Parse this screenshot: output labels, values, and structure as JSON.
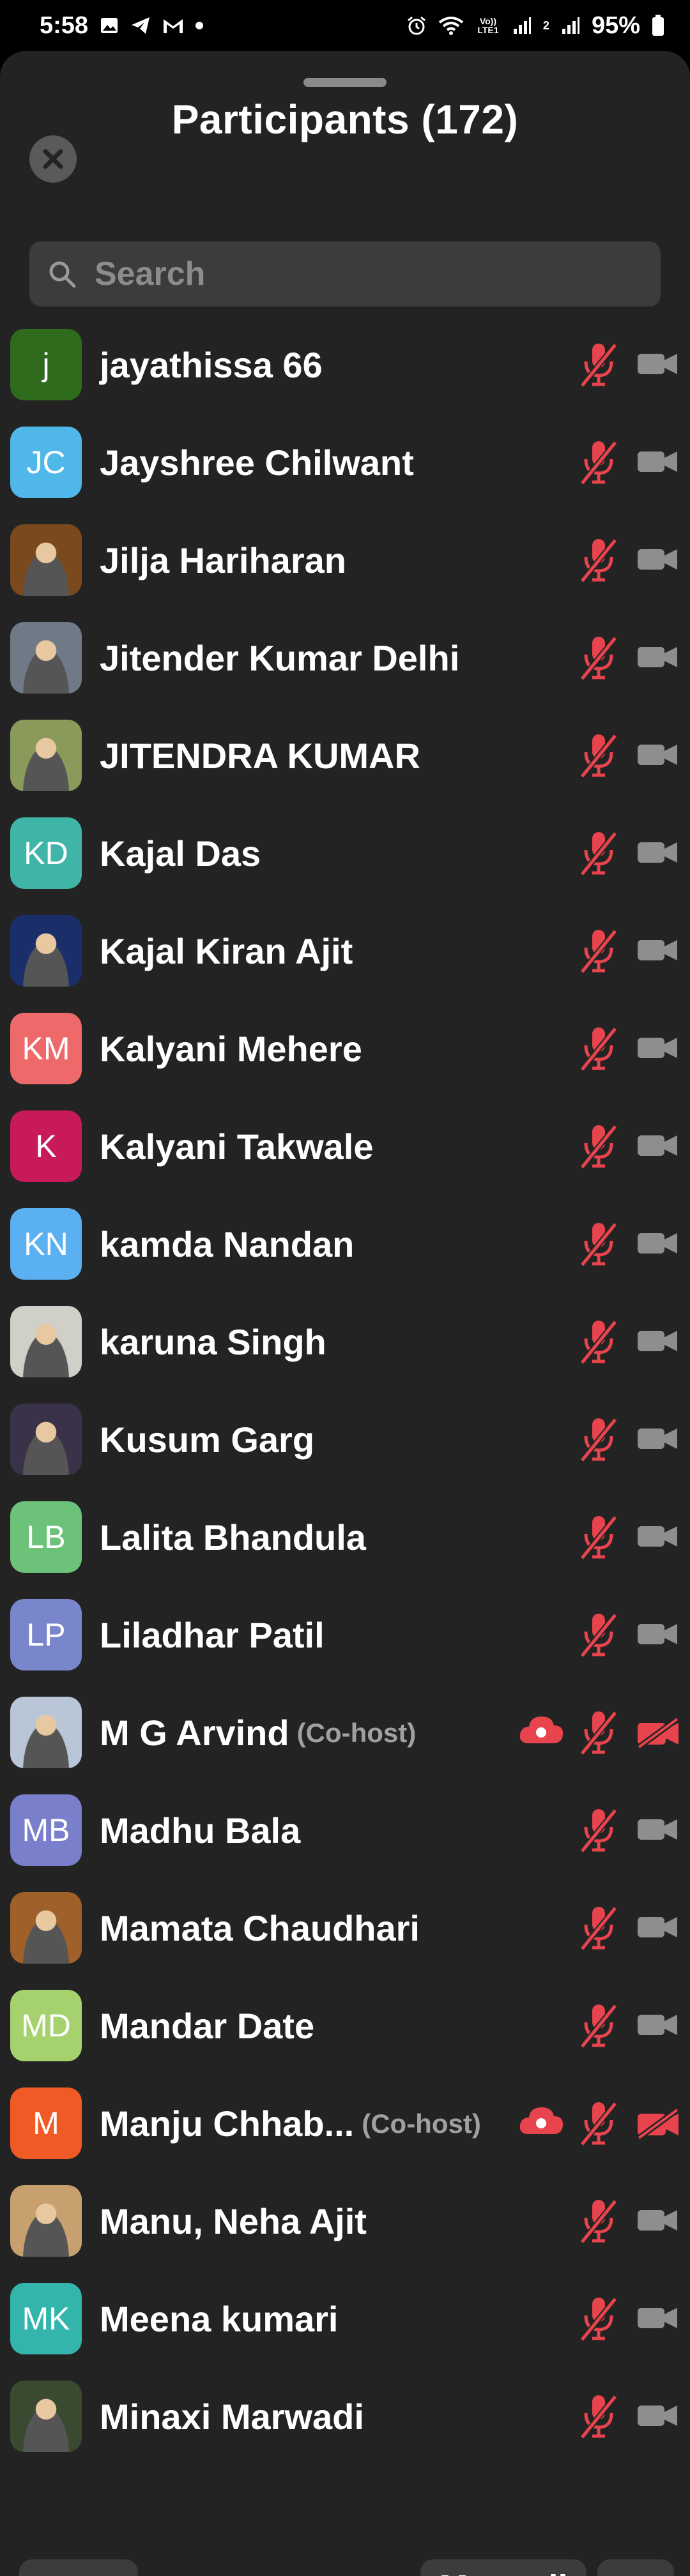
{
  "status_bar": {
    "time": "5:58",
    "battery": "95%",
    "network_label": "Vo)) LTE1",
    "sim2_label": "2"
  },
  "sheet": {
    "title": "Participants (172)",
    "search_placeholder": "Search"
  },
  "participants": [
    {
      "name": "jayathissa 66",
      "initials": "j",
      "avatar_color": "#2e6b1d",
      "photo": false
    },
    {
      "name": "Jayshree Chilwant",
      "initials": "JC",
      "avatar_color": "#4fb8e8",
      "photo": false
    },
    {
      "name": "Jilja Hariharan",
      "initials": "",
      "avatar_color": "#7a4a1e",
      "photo": true
    },
    {
      "name": "Jitender Kumar Delhi",
      "initials": "",
      "avatar_color": "#6f7a86",
      "photo": true
    },
    {
      "name": "JITENDRA KUMAR",
      "initials": "",
      "avatar_color": "#8a9a5a",
      "photo": true
    },
    {
      "name": "Kajal Das",
      "initials": "KD",
      "avatar_color": "#3fb5a8",
      "photo": false
    },
    {
      "name": "Kajal Kiran Ajit",
      "initials": "",
      "avatar_color": "#1a2f6a",
      "photo": true
    },
    {
      "name": "Kalyani Mehere",
      "initials": "KM",
      "avatar_color": "#ee6a6a",
      "photo": false
    },
    {
      "name": "Kalyani Takwale",
      "initials": "K",
      "avatar_color": "#c8195a",
      "photo": false
    },
    {
      "name": "kamda Nandan",
      "initials": "KN",
      "avatar_color": "#5ab0f0",
      "photo": false
    },
    {
      "name": "karuna Singh",
      "initials": "",
      "avatar_color": "#d0cfc8",
      "photo": true
    },
    {
      "name": "Kusum Garg",
      "initials": "",
      "avatar_color": "#3a3248",
      "photo": true
    },
    {
      "name": "Lalita Bhandula",
      "initials": "LB",
      "avatar_color": "#6dc27a",
      "photo": false
    },
    {
      "name": "Liladhar Patil",
      "initials": "LP",
      "avatar_color": "#7a86cc",
      "photo": false
    },
    {
      "name": "M G Arvind",
      "initials": "",
      "avatar_color": "#b8c6d8",
      "photo": true,
      "cohost": "(Co-host)",
      "recording": true,
      "video_off_red": true
    },
    {
      "name": "Madhu Bala",
      "initials": "MB",
      "avatar_color": "#7a7fcc",
      "photo": false
    },
    {
      "name": "Mamata Chaudhari",
      "initials": "",
      "avatar_color": "#a0602a",
      "photo": true
    },
    {
      "name": "Mandar Date",
      "initials": "MD",
      "avatar_color": "#a6d26e",
      "photo": false
    },
    {
      "name": "Manju Chhab...",
      "initials": "M",
      "avatar_color": "#f05a24",
      "photo": false,
      "cohost": "(Co-host)",
      "recording": true,
      "video_off_red": true
    },
    {
      "name": "Manu, Neha Ajit",
      "initials": "",
      "avatar_color": "#c8a070",
      "photo": true
    },
    {
      "name": "Meena kumari",
      "initials": "MK",
      "avatar_color": "#34b5ac",
      "photo": false
    },
    {
      "name": "Minaxi Marwadi",
      "initials": "",
      "avatar_color": "#3a4a30",
      "photo": true
    }
  ],
  "footer": {
    "invite_label": "Invite",
    "mute_all_label": "Mute all",
    "more_label": "···"
  },
  "colors": {
    "muted_red": "#e8444d",
    "cam_grey": "#8e8e8e",
    "sheet_bg": "#232323"
  }
}
